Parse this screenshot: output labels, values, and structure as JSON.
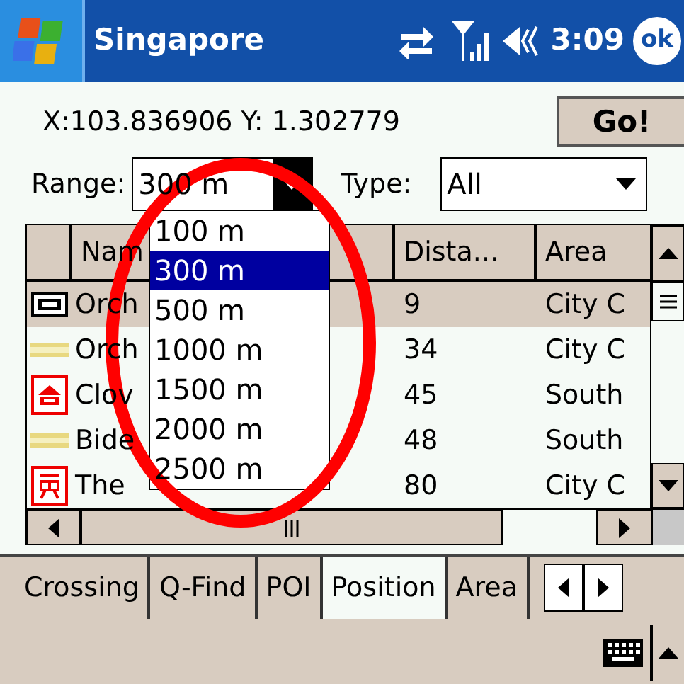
{
  "title_bar": {
    "title": "Singapore",
    "time": "3:09",
    "ok": "ok"
  },
  "position": {
    "coordinates": "X:103.836906 Y: 1.302779",
    "go_button": "Go!"
  },
  "range": {
    "label": "Range:",
    "value": "300 m",
    "expanded": true,
    "options": [
      {
        "label": "100 m",
        "selected": false
      },
      {
        "label": "300 m",
        "selected": true
      },
      {
        "label": "500 m",
        "selected": false
      },
      {
        "label": "1000 m",
        "selected": false
      },
      {
        "label": "1500 m",
        "selected": false
      },
      {
        "label": "2000 m",
        "selected": false
      },
      {
        "label": "2500 m",
        "selected": false
      }
    ]
  },
  "type": {
    "label": "Type:",
    "value": "All"
  },
  "table": {
    "columns": [
      "Nam",
      "Dista...",
      "Area"
    ],
    "rows": [
      {
        "kind": "bus-stop",
        "name": "Orch",
        "distance": "9",
        "area": "City C",
        "selected": true
      },
      {
        "kind": "road",
        "name": "Orch",
        "distance": "34",
        "area": "City C",
        "selected": false
      },
      {
        "kind": "hotel",
        "name": "Clov",
        "distance": "45",
        "area": "South",
        "selected": false
      },
      {
        "kind": "road",
        "name": "Bide",
        "distance": "48",
        "area": "South",
        "selected": false
      },
      {
        "kind": "shop",
        "name": "The",
        "distance": "80",
        "area": "City C",
        "selected": false
      }
    ]
  },
  "tabs": [
    {
      "label": "Crossing",
      "selected": false
    },
    {
      "label": "Q-Find",
      "selected": false
    },
    {
      "label": "POI",
      "selected": false
    },
    {
      "label": "Position",
      "selected": true
    },
    {
      "label": "Area",
      "selected": false
    }
  ]
}
